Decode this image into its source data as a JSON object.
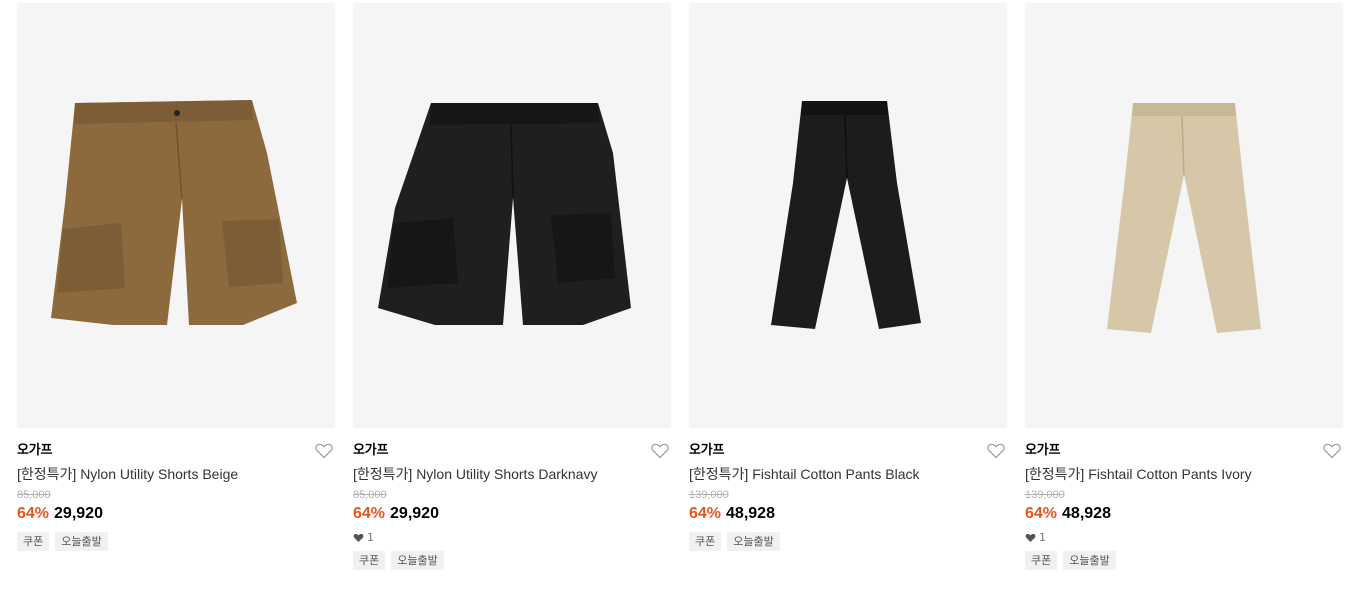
{
  "products": [
    {
      "brand": "오가프",
      "title": "[한정특가] Nylon Utility Shorts Beige",
      "original_price": "85,000",
      "discount": "64%",
      "price": "29,920",
      "likes": null,
      "tags": [
        "쿠폰",
        "오늘출발"
      ],
      "image": {
        "type": "shorts",
        "color": "#8c6a3e",
        "shade": "#6f5230"
      }
    },
    {
      "brand": "오가프",
      "title": "[한정특가] Nylon Utility Shorts Darknavy",
      "original_price": "85,000",
      "discount": "64%",
      "price": "29,920",
      "likes": "1",
      "tags": [
        "쿠폰",
        "오늘출발"
      ],
      "image": {
        "type": "shorts",
        "color": "#1e1f21",
        "shade": "#0f1011"
      }
    },
    {
      "brand": "오가프",
      "title": "[한정특가] Fishtail Cotton Pants Black",
      "original_price": "139,000",
      "discount": "64%",
      "price": "48,928",
      "likes": null,
      "tags": [
        "쿠폰",
        "오늘출발"
      ],
      "image": {
        "type": "pants",
        "color": "#1c1c1c",
        "shade": "#0d0d0d"
      }
    },
    {
      "brand": "오가프",
      "title": "[한정특가] Fishtail Cotton Pants Ivory",
      "original_price": "139,000",
      "discount": "64%",
      "price": "48,928",
      "likes": "1",
      "tags": [
        "쿠폰",
        "오늘출발"
      ],
      "image": {
        "type": "pants",
        "color": "#d6c7a8",
        "shade": "#bcab8a"
      }
    }
  ],
  "colors": {
    "discount": "#ee5120",
    "thumb_bg": "#f5f5f5",
    "tag_bg": "#f1f1f1"
  }
}
